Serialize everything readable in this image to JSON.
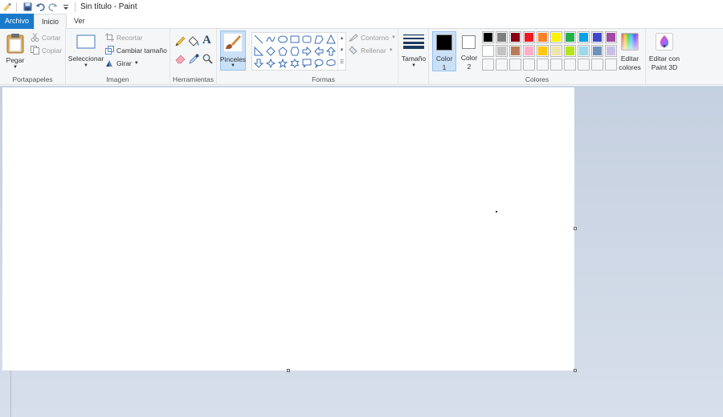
{
  "titlebar": {
    "title": "Sin título - Paint",
    "icons": [
      "paint-app-icon",
      "save-icon",
      "undo-icon",
      "redo-icon",
      "customize-qa-icon"
    ]
  },
  "tabs": [
    {
      "label": "Archivo"
    },
    {
      "label": "Inicio"
    },
    {
      "label": "Ver"
    }
  ],
  "clipboard": {
    "paste_label": "Pegar",
    "cut_label": "Cortar",
    "copy_label": "Copiar",
    "group_label": "Portapapeles"
  },
  "image": {
    "select_label": "Seleccionar",
    "crop_label": "Recortar",
    "resize_label": "Cambiar tamaño",
    "rotate_label": "Girar",
    "group_label": "Imagen"
  },
  "tools": {
    "group_label": "Herramientas",
    "items": [
      "pencil-icon",
      "fill-icon",
      "text-icon",
      "eraser-icon",
      "color-picker-icon",
      "magnifier-icon"
    ]
  },
  "brushes": {
    "label": "Pinceles"
  },
  "shapes": {
    "group_label": "Formas",
    "outline_label": "Contorno",
    "fill_label": "Rellenar"
  },
  "size": {
    "label": "Tamaño"
  },
  "colors": {
    "color1_label": "Color",
    "color1_num": "1",
    "color2_label": "Color",
    "color2_num": "2",
    "color1_value": "#000000",
    "color2_value": "#ffffff",
    "edit_label_1": "Editar",
    "edit_label_2": "colores",
    "group_label": "Colores",
    "palette_row1": [
      "#000000",
      "#7f7f7f",
      "#880015",
      "#ed1c24",
      "#ff7f27",
      "#fff200",
      "#22b14c",
      "#00a2e8",
      "#3f48cc",
      "#a349a4"
    ],
    "palette_row2": [
      "#ffffff",
      "#c3c3c3",
      "#b97a57",
      "#ffaec9",
      "#ffc90e",
      "#efe4b0",
      "#b5e61d",
      "#99d9ea",
      "#7092be",
      "#c8bfe7"
    ],
    "palette_row3": [
      "#f5f6f7",
      "#f5f6f7",
      "#f5f6f7",
      "#f5f6f7",
      "#f5f6f7",
      "#f5f6f7",
      "#f5f6f7",
      "#f5f6f7",
      "#f5f6f7",
      "#f5f6f7"
    ]
  },
  "paint3d": {
    "label_1": "Editar con",
    "label_2": "Paint 3D"
  },
  "accent": "#1979ca"
}
